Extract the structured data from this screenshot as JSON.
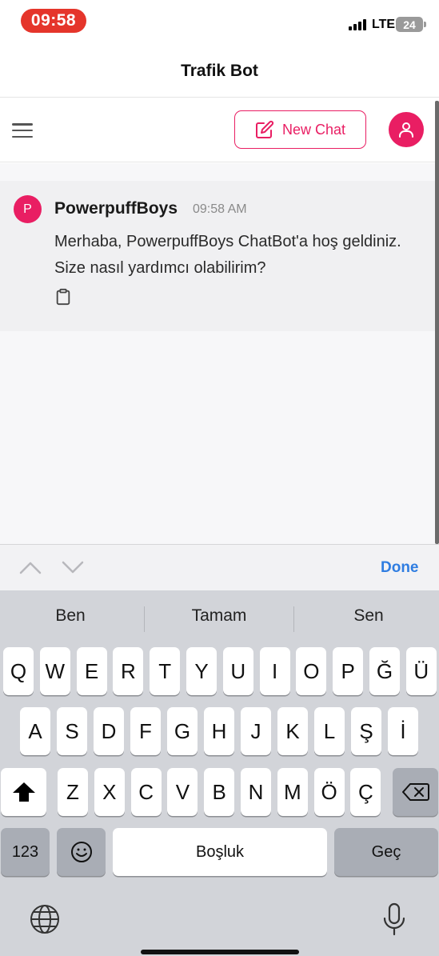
{
  "status_bar": {
    "time": "09:58",
    "network": "LTE",
    "battery": "24"
  },
  "screen_title": "Trafik Bot",
  "header": {
    "new_chat_label": "New Chat"
  },
  "message": {
    "avatar_letter": "P",
    "author": "PowerpuffBoys",
    "time": "09:58 AM",
    "text": "Merhaba, PowerpuffBoys ChatBot'a hoş geldiniz. Size nasıl yardımcı olabilirim?"
  },
  "keyboard_toolbar": {
    "done_label": "Done"
  },
  "keyboard": {
    "suggestions": [
      "Ben",
      "Tamam",
      "Sen"
    ],
    "row1": [
      "Q",
      "W",
      "E",
      "R",
      "T",
      "Y",
      "U",
      "I",
      "O",
      "P",
      "Ğ",
      "Ü"
    ],
    "row2": [
      "A",
      "S",
      "D",
      "F",
      "G",
      "H",
      "J",
      "K",
      "L",
      "Ş",
      "İ"
    ],
    "row3": [
      "Z",
      "X",
      "C",
      "V",
      "B",
      "N",
      "M",
      "Ö",
      "Ç"
    ],
    "numbers_label": "123",
    "space_label": "Boşluk",
    "return_label": "Geç"
  },
  "colors": {
    "accent": "#e91e63",
    "done": "#2f7de1",
    "time_pill": "#e5352b"
  }
}
